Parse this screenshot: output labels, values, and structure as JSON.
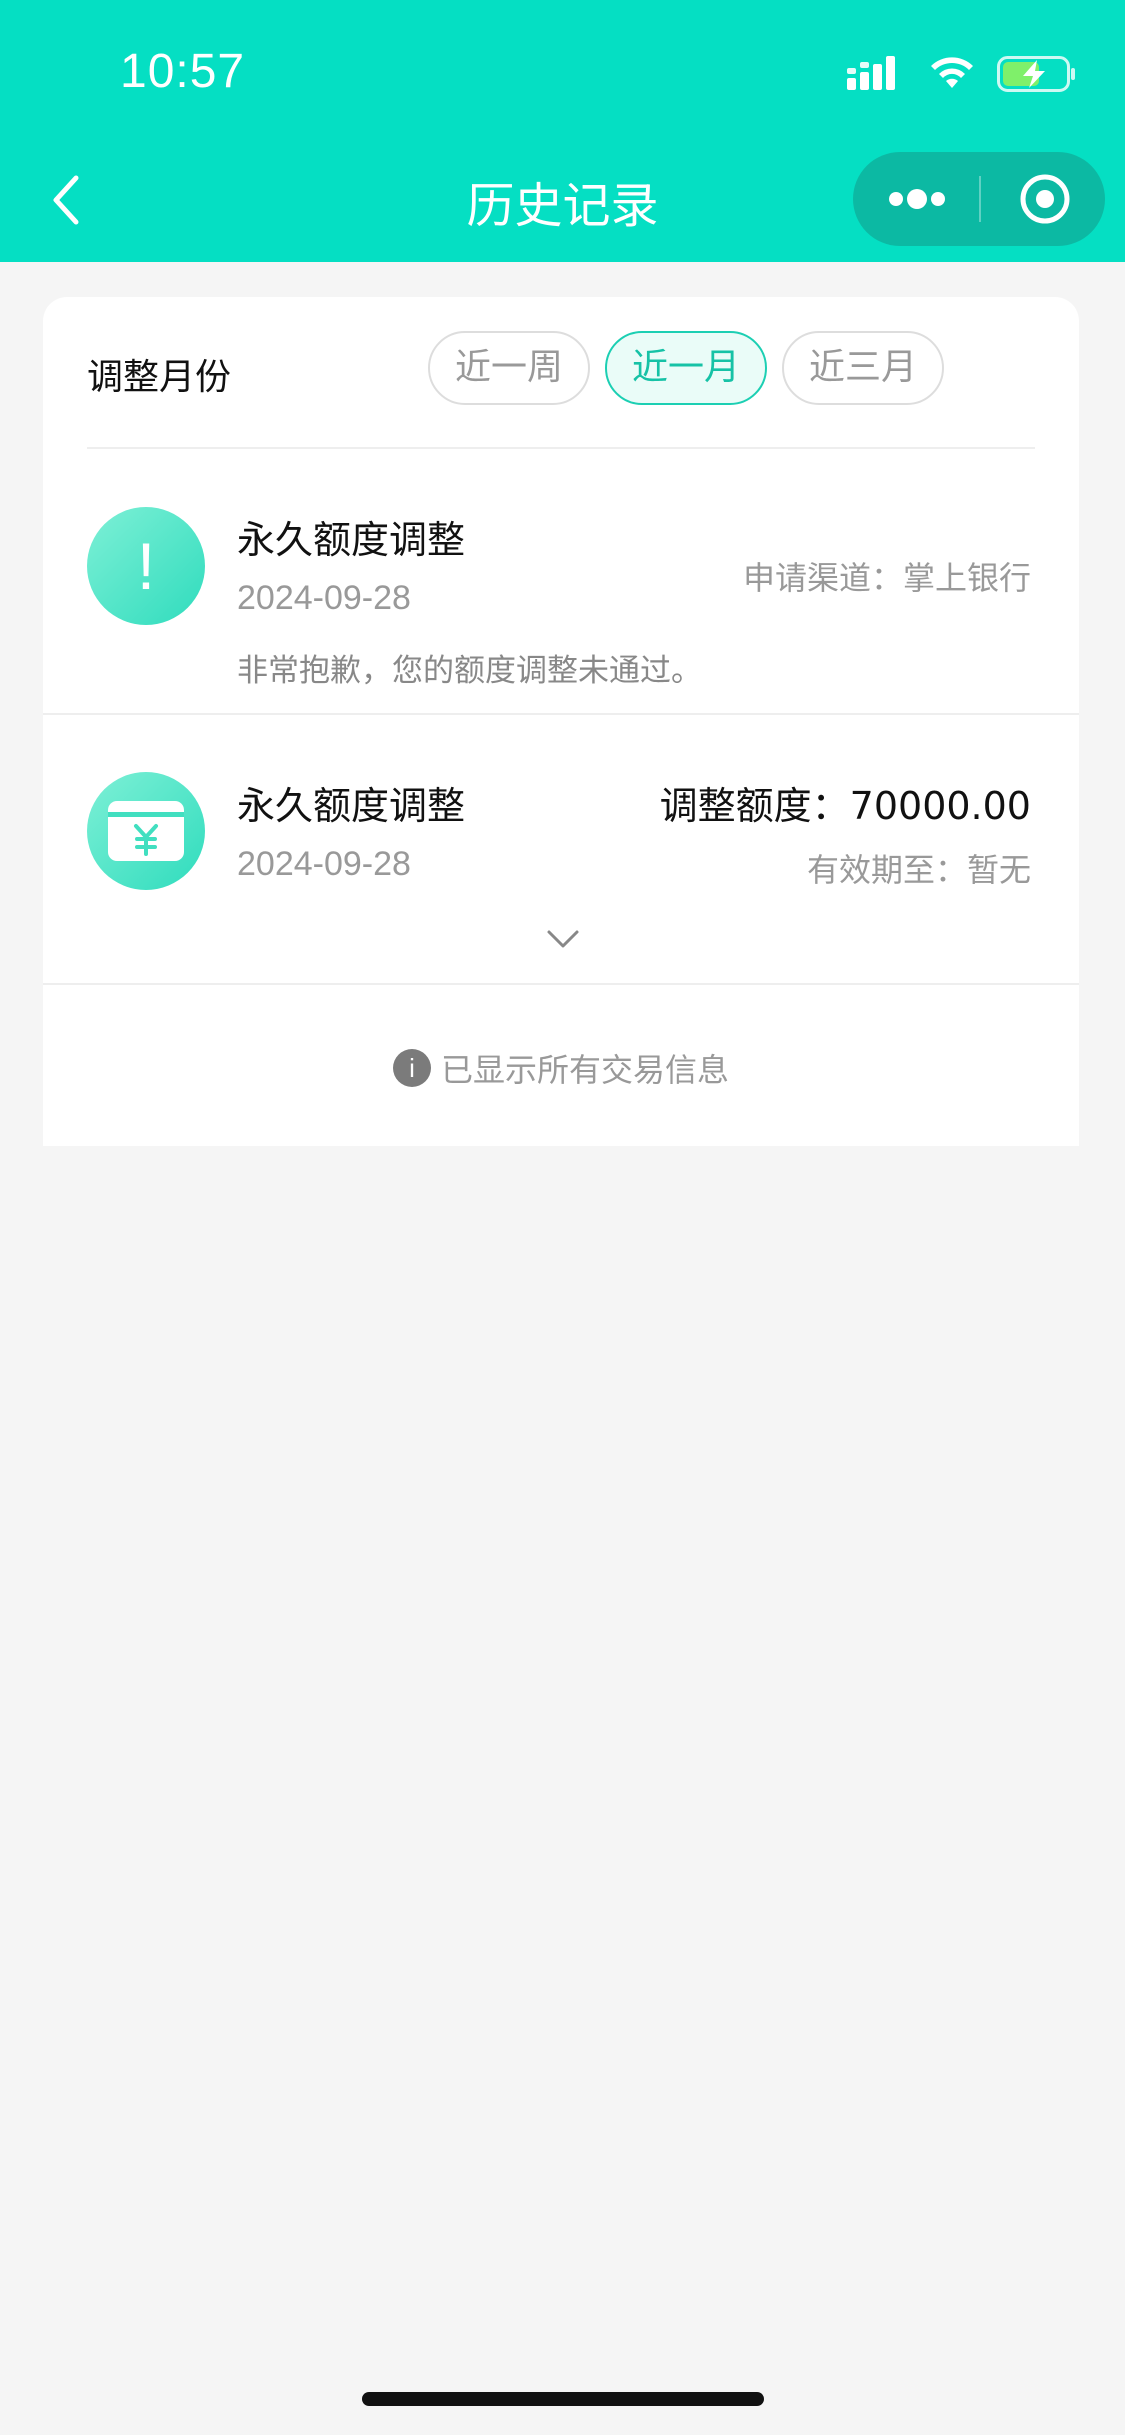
{
  "status_bar": {
    "time": "10:57"
  },
  "header": {
    "title": "历史记录",
    "bg_color": "#05dfc3"
  },
  "filter": {
    "label": "调整月份",
    "options": [
      {
        "label": "近一周",
        "selected": false
      },
      {
        "label": "近一月",
        "selected": true
      },
      {
        "label": "近三月",
        "selected": false
      }
    ]
  },
  "records": [
    {
      "icon": "warning-icon",
      "title": "永久额度调整",
      "date": "2024-09-28",
      "channel": "申请渠道：掌上银行",
      "note": "非常抱歉，您的额度调整未通过。"
    },
    {
      "icon": "yuan-card-icon",
      "title": "永久额度调整",
      "date": "2024-09-28",
      "amount": "调整额度：70000.00",
      "validity": "有效期至：暂无"
    }
  ],
  "footer": {
    "info_icon_glyph": "i",
    "message": "已显示所有交易信息"
  },
  "colors": {
    "accent": "#05dfc3",
    "chip_active_text": "#16c2a6",
    "muted_text": "#999999"
  }
}
